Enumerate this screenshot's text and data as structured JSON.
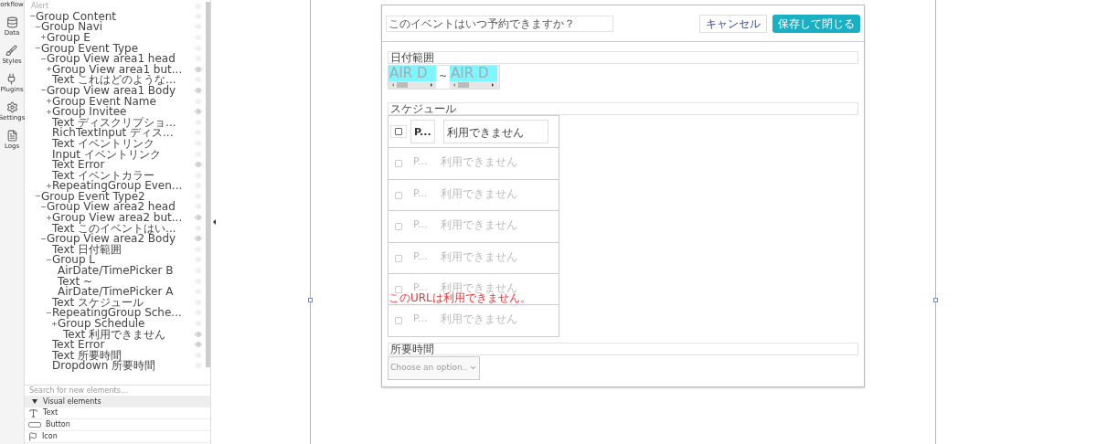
{
  "nav": [
    {
      "kind": "workflow",
      "label": "orkflow"
    },
    {
      "kind": "data",
      "label": "Data"
    },
    {
      "kind": "styles",
      "label": "Styles"
    },
    {
      "kind": "plugins",
      "label": "Plugins"
    },
    {
      "kind": "settings",
      "label": "Settings"
    },
    {
      "kind": "logs",
      "label": "Logs"
    }
  ],
  "tree_top": {
    "label": "Alert"
  },
  "tree": [
    {
      "label": "Group Content",
      "expanded": true,
      "eye_dark": false,
      "children": [
        {
          "label": "Group Navi",
          "expanded": true,
          "eye_dark": false,
          "children": [
            {
              "label": "Group E",
              "expanded": false,
              "eye_dark": false
            }
          ]
        },
        {
          "label": "Group Event Type",
          "expanded": true,
          "eye_dark": false,
          "children": [
            {
              "label": "Group View area1 head",
              "expanded": true,
              "eye_dark": false,
              "children": [
                {
                  "label": "Group View area1 but...",
                  "expanded": false,
                  "eye_dark": true
                },
                {
                  "label": "Text これはどのような...",
                  "eye_dark": false
                }
              ]
            },
            {
              "label": "Group View area1 Body",
              "expanded": true,
              "eye_dark": true,
              "children": [
                {
                  "label": "Group Event Name",
                  "expanded": false,
                  "eye_dark": false
                },
                {
                  "label": "Group Invitee",
                  "expanded": false,
                  "eye_dark": true
                },
                {
                  "label": "Text ディスクリプショ...",
                  "eye_dark": false
                },
                {
                  "label": "RichTextInput ディス...",
                  "eye_dark": false
                },
                {
                  "label": "Text イベントリンク",
                  "eye_dark": false
                },
                {
                  "label": "Input イベントリンク",
                  "eye_dark": false
                },
                {
                  "label": "Text Error",
                  "eye_dark": true
                },
                {
                  "label": "Text イベントカラー",
                  "eye_dark": false
                },
                {
                  "label": "RepeatingGroup Even...",
                  "expanded": false,
                  "eye_dark": false
                }
              ]
            }
          ]
        },
        {
          "label": "Group Event Type2",
          "expanded": true,
          "eye_dark": false,
          "children": [
            {
              "label": "Group View area2 head",
              "expanded": true,
              "eye_dark": false,
              "children": [
                {
                  "label": "Group View area2 but...",
                  "expanded": false,
                  "eye_dark": true
                },
                {
                  "label": "Text このイベントはい...",
                  "eye_dark": false
                }
              ]
            },
            {
              "label": "Group View area2 Body",
              "expanded": true,
              "eye_dark": true,
              "children": [
                {
                  "label": "Text 日付範囲",
                  "eye_dark": false
                },
                {
                  "label": "Group L",
                  "expanded": true,
                  "eye_dark": false,
                  "children": [
                    {
                      "label": "AirDate/TimePicker B",
                      "eye_dark": false
                    },
                    {
                      "label": "Text ~",
                      "eye_dark": false
                    },
                    {
                      "label": "AirDate/TimePicker A",
                      "eye_dark": false
                    }
                  ]
                },
                {
                  "label": "Text スケジュール",
                  "eye_dark": false
                },
                {
                  "label": "RepeatingGroup Sche...",
                  "expanded": true,
                  "eye_dark": false,
                  "children": [
                    {
                      "label": "Group Schedule",
                      "expanded": false,
                      "eye_dark": false,
                      "children": [
                        {
                          "label": "Text 利用できません",
                          "eye_dark": true
                        }
                      ]
                    }
                  ]
                },
                {
                  "label": "Text Error",
                  "eye_dark": true
                },
                {
                  "label": "Text 所要時間",
                  "eye_dark": false
                },
                {
                  "label": "Dropdown 所要時間",
                  "eye_dark": false
                }
              ]
            }
          ]
        }
      ]
    }
  ],
  "element_search": {
    "placeholder": "Search for new elements..."
  },
  "palette": {
    "header": "Visual elements",
    "expanded": true,
    "items": [
      {
        "kind": "text",
        "label": "Text"
      },
      {
        "kind": "button",
        "label": "Button"
      },
      {
        "kind": "icon",
        "label": "Icon"
      }
    ]
  },
  "popup": {
    "title": "このイベントはいつ予約できますか？",
    "cancel": "キャンセル",
    "save": "保存して閉じる",
    "date_label": "日付範囲",
    "date_from": "AIR D",
    "separator": "~",
    "date_to": "AIR D",
    "schedule_label": "スケジュール",
    "schedule_rows": [
      {
        "kind": "template",
        "checked": false,
        "code": "P...",
        "status": "利用できません"
      },
      {
        "kind": "repeat",
        "checked": false,
        "code": "P...",
        "status": "利用できません"
      },
      {
        "kind": "repeat",
        "checked": false,
        "code": "P...",
        "status": "利用できません"
      },
      {
        "kind": "repeat",
        "checked": false,
        "code": "P...",
        "status": "利用できません"
      },
      {
        "kind": "repeat",
        "checked": false,
        "code": "P...",
        "status": "利用できません"
      },
      {
        "kind": "repeat",
        "checked": false,
        "code": "P...",
        "status": "利用できません"
      },
      {
        "kind": "repeat",
        "checked": false,
        "code": "P...",
        "status": "利用できません"
      }
    ],
    "error": "このURLは利用できません。",
    "duration_label": "所要時間",
    "duration_placeholder": "Choose an option.."
  }
}
